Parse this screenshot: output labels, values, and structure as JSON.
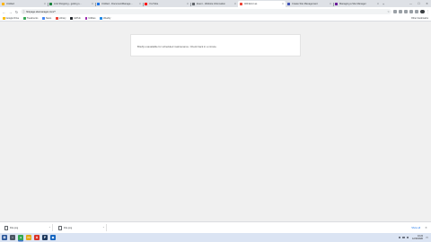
{
  "tabs": [
    {
      "title": "Untitled",
      "color": "#ffb300",
      "active": false
    },
    {
      "title": "Link Shopping - getting s...",
      "color": "#188038",
      "active": false
    },
    {
      "title": "Untitled - DocumentManage...",
      "color": "#1a73e8",
      "active": false
    },
    {
      "title": "YouTube",
      "color": "#ff0000",
      "active": false
    },
    {
      "title": "Event - Website Information",
      "color": "#5f6368",
      "active": false
    },
    {
      "title": "400 Error as",
      "color": "#ea4335",
      "active": true
    },
    {
      "title": "Create Site Management",
      "color": "#3f51b5",
      "active": false
    },
    {
      "title": "Managing a Site Manager",
      "color": "#6a1b9a",
      "active": false
    }
  ],
  "toolbar": {
    "back": "←",
    "forward": "→",
    "reload": "↻",
    "url": "firstpage.sitemanager.com/?",
    "lock": "ⓘ",
    "star": "☆",
    "menu": "⋮"
  },
  "bookmarks": [
    {
      "label": "Google Drive",
      "color": "#fbbc04"
    },
    {
      "label": "Treatments",
      "color": "#34a853"
    },
    {
      "label": "News",
      "color": "#4285f4"
    },
    {
      "label": "Library",
      "color": "#ea4335"
    },
    {
      "label": "GitHub",
      "color": "#24292e"
    },
    {
      "label": "Utilities",
      "color": "#9c27b0"
    },
    {
      "label": "Weebly",
      "color": "#1e88e5"
    }
  ],
  "bookmarks_other": "Other bookmarks",
  "message": {
    "text": "Briefly unavailable for scheduled maintenance. Check back in a minute."
  },
  "downloads": [
    {
      "name": "File.png"
    },
    {
      "name": "File.png"
    }
  ],
  "downloads_show_all": "Show all",
  "downloads_close": "✕",
  "taskbar": [
    {
      "name": "start",
      "glyph": "⊞",
      "color": "#2b579a"
    },
    {
      "name": "search",
      "glyph": "○",
      "color": "#4b5563"
    },
    {
      "name": "chrome",
      "glyph": "●",
      "color": "#34a853"
    },
    {
      "name": "file-explorer",
      "glyph": "▭",
      "color": "#e6a817"
    },
    {
      "name": "acrobat",
      "glyph": "A",
      "color": "#d93025"
    },
    {
      "name": "photoshop",
      "glyph": "P",
      "color": "#1e3a5f"
    },
    {
      "name": "app-blue",
      "glyph": "◆",
      "color": "#1565c0"
    }
  ],
  "tray": {
    "time": "10:22",
    "date": "12/10/2020"
  }
}
